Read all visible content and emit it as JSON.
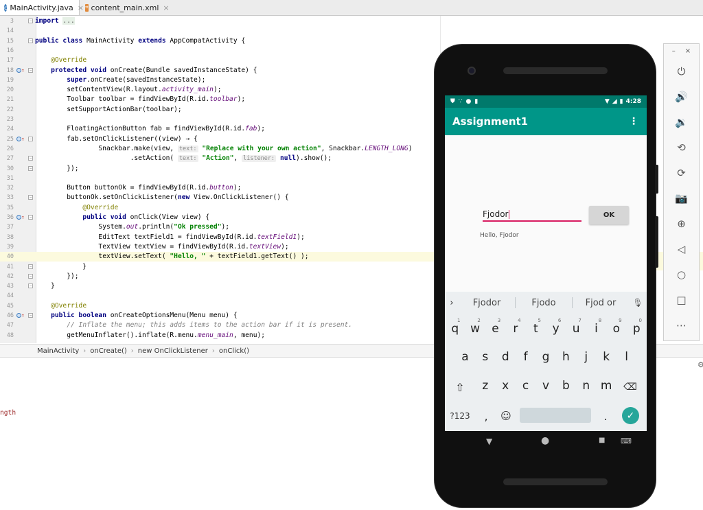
{
  "tabs": [
    {
      "label": "MainActivity.java",
      "icon": "java-class-icon",
      "active": true
    },
    {
      "label": "content_main.xml",
      "icon": "xml-file-icon",
      "active": false
    }
  ],
  "code_lines": [
    {
      "n": "3",
      "html": "<span class=\"kw\">import</span> <span class=\"fold-text\">...</span>"
    },
    {
      "n": "14",
      "html": ""
    },
    {
      "n": "15",
      "html": "<span class=\"kw\">public class</span> MainActivity <span class=\"kw\">extends</span> AppCompatActivity {"
    },
    {
      "n": "16",
      "html": ""
    },
    {
      "n": "17",
      "html": "    <span class=\"an\">@Override</span>"
    },
    {
      "n": "18",
      "html": "    <span class=\"kw\">protected void</span> onCreate(Bundle savedInstanceState) {"
    },
    {
      "n": "19",
      "html": "        <span class=\"kw\">super</span>.onCreate(savedInstanceState);"
    },
    {
      "n": "20",
      "html": "        setContentView(R.layout.<span class=\"fld\">activity_main</span>);"
    },
    {
      "n": "21",
      "html": "        Toolbar toolbar = findViewById(R.id.<span class=\"fld\">toolbar</span>);"
    },
    {
      "n": "22",
      "html": "        setSupportActionBar(toolbar);"
    },
    {
      "n": "23",
      "html": ""
    },
    {
      "n": "24",
      "html": "        FloatingActionButton fab = findViewById(R.id.<span class=\"fld\">fab</span>);"
    },
    {
      "n": "25",
      "html": "        fab.setOnClickListener((view) → {"
    },
    {
      "n": "26",
      "html": "                Snackbar.make(view, <span class=\"hint\">text:</span> <span class=\"str\">\"Replace with your own action\"</span>, Snackbar.<span class=\"fld\">LENGTH_LONG</span>)"
    },
    {
      "n": "27",
      "html": "                        .setAction( <span class=\"hint\">text:</span> <span class=\"str\">\"Action\"</span>, <span class=\"hint\">listener:</span> <span class=\"kw\">null</span>).show();"
    },
    {
      "n": "30",
      "html": "        });"
    },
    {
      "n": "31",
      "html": ""
    },
    {
      "n": "32",
      "html": "        Button buttonOk = findViewById(R.id.<span class=\"fld\">button</span>);"
    },
    {
      "n": "33",
      "html": "        buttonOk.setOnClickListener(<span class=\"kw\">new</span> View.OnClickListener() {"
    },
    {
      "n": "35",
      "html": "            <span class=\"an\">@Override</span>"
    },
    {
      "n": "36",
      "html": "            <span class=\"kw\">public void</span> onClick(View view) {"
    },
    {
      "n": "37",
      "html": "                System.<span class=\"fld\">out</span>.println(<span class=\"str\">\"Ok pressed\"</span>);"
    },
    {
      "n": "38",
      "html": "                EditText textField1 = findViewById(R.id.<span class=\"fld\">textField1</span>);"
    },
    {
      "n": "39",
      "html": "                TextView textView = findViewById(R.id.<span class=\"fld\">textView</span>);"
    },
    {
      "n": "40",
      "html": "                textView.setText( <span class=\"str\">\"Hello, \"</span> + textField1.getText() );"
    },
    {
      "n": "41",
      "html": "            }"
    },
    {
      "n": "42",
      "html": "        });"
    },
    {
      "n": "43",
      "html": "    }"
    },
    {
      "n": "44",
      "html": ""
    },
    {
      "n": "45",
      "html": "    <span class=\"an\">@Override</span>"
    },
    {
      "n": "46",
      "html": "    <span class=\"kw\">public boolean</span> onCreateOptionsMenu(Menu menu) {"
    },
    {
      "n": "47",
      "html": "        <span class=\"cmt\">// Inflate the menu; this adds items to the action bar if it is present.</span>"
    },
    {
      "n": "48",
      "html": "        getMenuInflater().inflate(R.menu.<span class=\"fld\">menu_main</span>, menu);"
    }
  ],
  "breadcrumb": [
    "MainActivity",
    "onCreate()",
    "new OnClickListener",
    "onClick()"
  ],
  "bottom_text": "ngth",
  "phone": {
    "status_time": "4:28",
    "app_title": "Assignment1",
    "text_field_value": "Fjodor",
    "ok_label": "OK",
    "result_text": "Hello, Fjodor",
    "suggestions": [
      "Fjodor",
      "Fjodo",
      "Fjod or"
    ],
    "row1": [
      [
        "q",
        "1"
      ],
      [
        "w",
        "2"
      ],
      [
        "e",
        "3"
      ],
      [
        "r",
        "4"
      ],
      [
        "t",
        "5"
      ],
      [
        "y",
        "6"
      ],
      [
        "u",
        "7"
      ],
      [
        "i",
        "8"
      ],
      [
        "o",
        "9"
      ],
      [
        "p",
        "0"
      ]
    ],
    "row2": [
      "a",
      "s",
      "d",
      "f",
      "g",
      "h",
      "j",
      "k",
      "l"
    ],
    "row3": [
      "z",
      "x",
      "c",
      "v",
      "b",
      "n",
      "m"
    ],
    "symbols_label": "?123",
    "comma": ",",
    "period": "."
  },
  "emulator_toolbar": [
    "power-icon",
    "volume-up-icon",
    "volume-down-icon",
    "rotate-left-icon",
    "rotate-right-icon",
    "camera-icon",
    "zoom-icon",
    "back-icon",
    "home-icon",
    "overview-icon",
    "more-icon"
  ],
  "colors": {
    "accent": "#009688",
    "status": "#00796b",
    "field_underline": "#d81b60",
    "enter": "#26a69a"
  }
}
